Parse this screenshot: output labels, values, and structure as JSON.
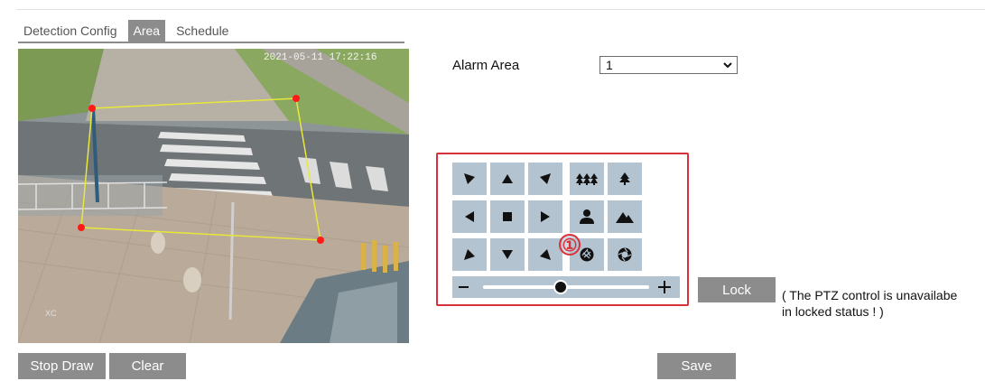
{
  "tabs": [
    {
      "label": "Detection Config",
      "active": false
    },
    {
      "label": "Area",
      "active": true
    },
    {
      "label": "Schedule",
      "active": false
    }
  ],
  "video": {
    "timestamp": "2021-05-11 17:22:16",
    "corner_label": "XC"
  },
  "alarm_area": {
    "label": "Alarm Area",
    "value": "1"
  },
  "ptz": {
    "marker": "①",
    "buttons": [
      {
        "name": "pan-up-left-icon"
      },
      {
        "name": "pan-up-icon"
      },
      {
        "name": "pan-up-right-icon"
      },
      {
        "name": "zoom-wide-icon"
      },
      {
        "name": "zoom-tele-icon"
      },
      {
        "name": "pan-left-icon"
      },
      {
        "name": "stop-icon"
      },
      {
        "name": "pan-right-icon"
      },
      {
        "name": "focus-near-icon"
      },
      {
        "name": "focus-far-icon"
      },
      {
        "name": "pan-down-left-icon"
      },
      {
        "name": "pan-down-icon"
      },
      {
        "name": "pan-down-right-icon"
      },
      {
        "name": "iris-close-icon"
      },
      {
        "name": "iris-open-icon"
      }
    ],
    "speed_slider": {
      "minus": "−",
      "plus": "+",
      "value_fraction": 0.47
    }
  },
  "lock_button": "Lock",
  "lock_note_line1": "( The PTZ control is unavailabe",
  "lock_note_line2": "in locked status ! )",
  "stop_draw_button": "Stop Draw",
  "clear_button": "Clear",
  "save_button": "Save",
  "colors": {
    "button_gray": "#8c8c8c",
    "ptz_button": "#b3c3cf",
    "highlight_red": "#d9303a",
    "area_polygon": "#e8e83a",
    "area_vertex": "#ff1a1a"
  }
}
